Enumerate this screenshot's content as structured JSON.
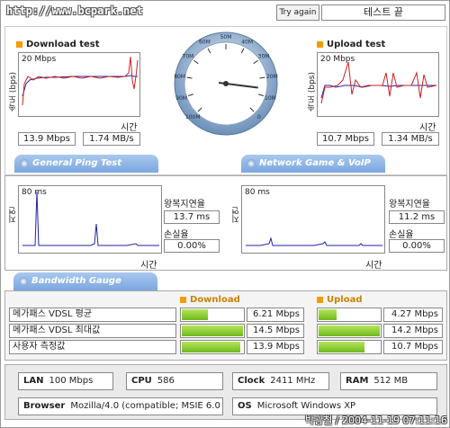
{
  "header": {
    "site_url": "http://www.bcpark.net",
    "try_again": "Try again",
    "test_end": "테스트 끝"
  },
  "download": {
    "title": "Download test",
    "ylabel": "속도 (bps)",
    "ymax_label": "20 Mbps",
    "time_label": "시간",
    "speed_mbps": "13.9 Mbps",
    "speed_mbytes": "1.74 MB/s"
  },
  "upload": {
    "title": "Upload test",
    "ylabel": "속도 (bps)",
    "ymax_label": "20 Mbps",
    "time_label": "시간",
    "speed_mbps": "10.7 Mbps",
    "speed_mbytes": "1.34 MB/s"
  },
  "gauge": {
    "ticks": [
      "100M",
      "90M",
      "80M",
      "70M",
      "60M",
      "50M",
      "40M",
      "30M",
      "20M",
      "10M",
      "0"
    ],
    "needle_mbps": 14
  },
  "ping": {
    "header": "General Ping Test",
    "ylabel": "지연 (ms)",
    "ymax_label": "80 ms",
    "time_label": "시간",
    "rtt_label": "왕복지연율",
    "rtt_value": "13.7 ms",
    "loss_label": "손실율",
    "loss_value": "0.00%"
  },
  "game": {
    "header": "Network Game & VoIP Test",
    "ylabel": "지연 (ms)",
    "ymax_label": "80 ms",
    "time_label": "시간",
    "rtt_label": "왕복지연율",
    "rtt_value": "11.2 ms",
    "loss_label": "손실율",
    "loss_value": "0.00%"
  },
  "bandwidth": {
    "header": "Bandwidth Gauge",
    "download_label": "Download",
    "upload_label": "Upload",
    "rows": [
      {
        "label": "메가패스 VDSL 평균",
        "down": "6.21 Mbps",
        "down_frac": 0.43,
        "up": "4.27 Mbps",
        "up_frac": 0.3
      },
      {
        "label": "메가패스 VDSL 최대값",
        "down": "14.5 Mbps",
        "down_frac": 1.0,
        "up": "14.2 Mbps",
        "up_frac": 1.0
      },
      {
        "label": "사용자 측정값",
        "down": "13.9 Mbps",
        "down_frac": 0.96,
        "up": "10.7 Mbps",
        "up_frac": 0.75
      }
    ]
  },
  "system": {
    "lan_label": "LAN",
    "lan_value": "100 Mbps",
    "cpu_label": "CPU",
    "cpu_value": "586",
    "clock_label": "Clock",
    "clock_value": "2411 MHz",
    "ram_label": "RAM",
    "ram_value": "512 MB",
    "browser_label": "Browser",
    "browser_value": "Mozilla/4.0 (compatible; MSIE 6.0",
    "os_label": "OS",
    "os_value": "Microsoft Windows XP"
  },
  "watermark": "박광철 / 2004-11-19 07:11:16",
  "colors": {
    "accent_orange": "#f59b00",
    "tab_blue": "#7ba7e0",
    "bar_green": "#6fb81e",
    "down_line": "#cc2222",
    "up_line": "#2222aa"
  }
}
